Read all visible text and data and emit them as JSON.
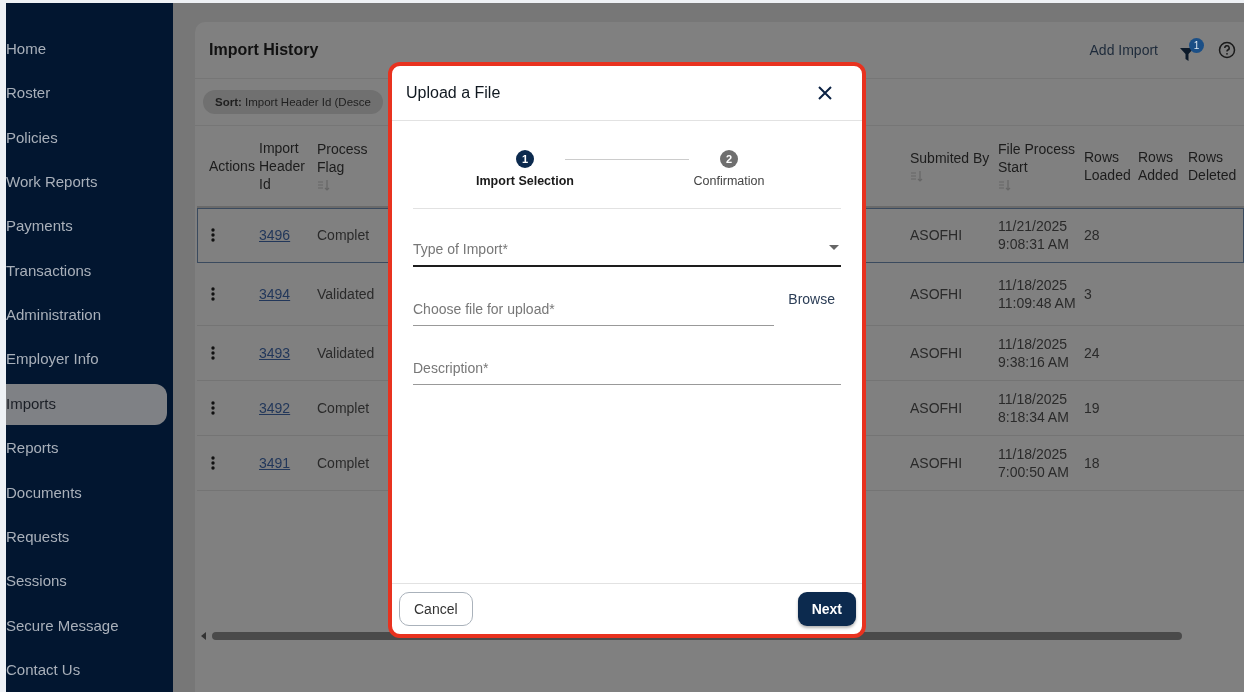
{
  "sidebar": {
    "items": [
      {
        "label": "Home",
        "selected": false
      },
      {
        "label": "Roster",
        "selected": false
      },
      {
        "label": "Policies",
        "selected": false
      },
      {
        "label": "Work Reports",
        "selected": false
      },
      {
        "label": "Payments",
        "selected": false
      },
      {
        "label": "Transactions",
        "selected": false
      },
      {
        "label": "Administration",
        "selected": false
      },
      {
        "label": "Employer Info",
        "selected": false
      },
      {
        "label": "Imports",
        "selected": true
      },
      {
        "label": "Reports",
        "selected": false
      },
      {
        "label": "Documents",
        "selected": false
      },
      {
        "label": "Requests",
        "selected": false
      },
      {
        "label": "Sessions",
        "selected": false
      },
      {
        "label": "Secure Message",
        "selected": false
      },
      {
        "label": "Contact Us",
        "selected": false
      }
    ]
  },
  "page": {
    "title": "Import History",
    "add_import": "Add Import",
    "filter_badge": "1"
  },
  "sort_chip": {
    "label": "Sort:",
    "value": "Import Header Id (Desce"
  },
  "table": {
    "columns_left": [
      {
        "label": "Actions",
        "sortable": false
      },
      {
        "label": "Import Header Id",
        "sortable": false
      },
      {
        "label": "Process Flag",
        "sortable": true
      }
    ],
    "columns_right": [
      {
        "label": "Submited By",
        "sortable": true
      },
      {
        "label": "File Process Start",
        "sortable": true
      },
      {
        "label": "Rows Loaded",
        "sortable": false
      },
      {
        "label": "Rows Added",
        "sortable": false
      },
      {
        "label": "Rows Deleted",
        "sortable": false
      }
    ],
    "rows": [
      {
        "selected": true,
        "id": "3496",
        "process_flag": "Complet",
        "submitted_by": "ASOFHI",
        "file_process_start": "11/21/2025 9:08:31 AM",
        "rows_loaded": "28"
      },
      {
        "selected": false,
        "id": "3494",
        "process_flag": "Validated",
        "submitted_by": "ASOFHI",
        "file_process_start": "11/18/2025 11:09:48 AM",
        "rows_loaded": "3"
      },
      {
        "selected": false,
        "id": "3493",
        "process_flag": "Validated",
        "submitted_by": "ASOFHI",
        "file_process_start": "11/18/2025 9:38:16 AM",
        "rows_loaded": "24"
      },
      {
        "selected": false,
        "id": "3492",
        "process_flag": "Complet",
        "submitted_by": "ASOFHI",
        "file_process_start": "11/18/2025 8:18:34 AM",
        "rows_loaded": "19"
      },
      {
        "selected": false,
        "id": "3491",
        "process_flag": "Complet",
        "submitted_by": "ASOFHI",
        "file_process_start": "11/18/2025 7:00:50 AM",
        "rows_loaded": "18"
      }
    ]
  },
  "dialog": {
    "title": "Upload a File",
    "steps": [
      {
        "number": "1",
        "label": "Import Selection",
        "selected": true
      },
      {
        "number": "2",
        "label": "Confirmation",
        "selected": false
      }
    ],
    "fields": [
      {
        "kind": "select",
        "placeholder": "Type of Import*",
        "focused": true
      },
      {
        "kind": "file",
        "placeholder": "Choose file for upload*",
        "action": "Browse",
        "focused": false
      },
      {
        "kind": "text",
        "placeholder": "Description*",
        "focused": false
      }
    ],
    "cancel": "Cancel",
    "next": "Next"
  }
}
